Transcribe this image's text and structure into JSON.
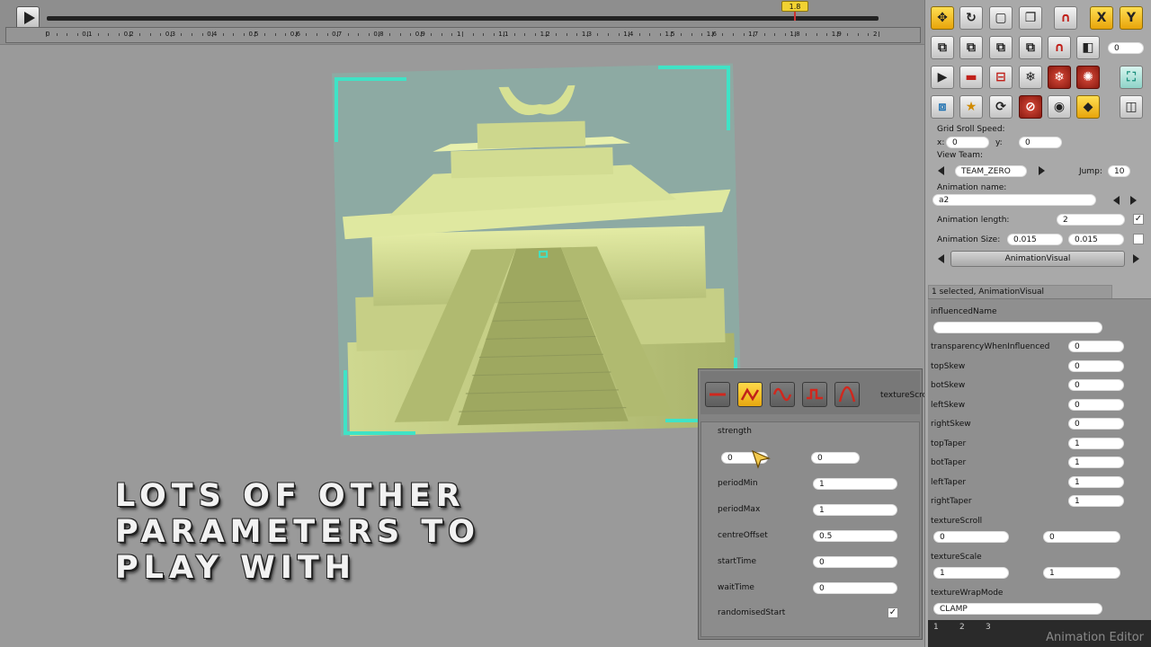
{
  "timeline": {
    "playhead_value": "1.8",
    "ticks": [
      "0",
      "0.1",
      "0.2",
      "0.3",
      "0.4",
      "0.5",
      "0.6",
      "0.7",
      "0.8",
      "0.9",
      "1",
      "1.1",
      "1.2",
      "1.3",
      "1.4",
      "1.5",
      "1.6",
      "1.7",
      "1.8",
      "1.9",
      "2"
    ]
  },
  "overlay": {
    "line1": "LOTS OF OTHER",
    "line2": "PARAMETERS TO",
    "line3": "PLAY WiTH"
  },
  "texture_scroll_panel": {
    "title": "textureScroll",
    "wave_buttons": [
      "flat-wave-icon",
      "triangle-wave-icon",
      "sine-wave-icon",
      "square-wave-icon",
      "spike-wave-icon"
    ],
    "active_wave": "triangle-wave-icon",
    "strength_label": "strength",
    "strength_a": "0",
    "strength_b": "0",
    "rows": [
      {
        "label": "periodMin",
        "value": "1"
      },
      {
        "label": "periodMax",
        "value": "1"
      },
      {
        "label": "centreOffset",
        "value": "0.5"
      },
      {
        "label": "startTime",
        "value": "0"
      },
      {
        "label": "waitTime",
        "value": "0"
      }
    ],
    "randomised_label": "randomisedStart",
    "randomised_checked": "✓"
  },
  "toolbar": {
    "row1": [
      "move-icon",
      "refresh-icon",
      "layer-icon",
      "duplicate-icon",
      "magnet-icon",
      "x-axis-icon",
      "y-axis-icon"
    ],
    "row2": [
      "send-back-icon",
      "bring-forward-icon",
      "stack-icon",
      "ungroup-icon",
      "magnet-small-icon",
      "flip-icon"
    ],
    "row2_value": "0",
    "row3": [
      "play-icon",
      "record-icon",
      "split-icon",
      "snow-icon",
      "snow-red-icon",
      "wheel-red-icon",
      "fit-icon"
    ],
    "row4": [
      "group-icon",
      "star-icon",
      "cycle-icon",
      "no-eye-icon",
      "eye-icon",
      "keyframe-icon",
      "mirror-icon"
    ]
  },
  "settings": {
    "grid_scroll_label": "Grid Sroll Speed:",
    "x_label": "x:",
    "x_value": "0",
    "y_label": "y:",
    "y_value": "0",
    "view_team_label": "View Team:",
    "team_value": "TEAM_ZERO",
    "jump_label": "Jump:",
    "jump_value": "10",
    "anim_name_label": "Animation name:",
    "anim_name_value": "a2",
    "anim_length_label": "Animation length:",
    "anim_length_value": "2",
    "anim_length_checked": "✓",
    "anim_size_label": "Animation Size:",
    "anim_size_x": "0.015",
    "anim_size_y": "0.015",
    "visual_selector": "AnimationVisual"
  },
  "properties": {
    "selection_tab": "1 selected, AnimationVisual",
    "influenced_name_label": "influencedName",
    "influenced_name_value": "",
    "rows": [
      {
        "label": "transparencyWhenInfluenced",
        "value": "0"
      },
      {
        "label": "topSkew",
        "value": "0"
      },
      {
        "label": "botSkew",
        "value": "0"
      },
      {
        "label": "leftSkew",
        "value": "0"
      },
      {
        "label": "rightSkew",
        "value": "0"
      },
      {
        "label": "topTaper",
        "value": "1"
      },
      {
        "label": "botTaper",
        "value": "1"
      },
      {
        "label": "leftTaper",
        "value": "1"
      },
      {
        "label": "rightTaper",
        "value": "1"
      }
    ],
    "texture_scroll_label": "textureScroll",
    "texture_scroll_a": "0",
    "texture_scroll_b": "0",
    "texture_scale_label": "textureScale",
    "texture_scale_a": "1",
    "texture_scale_b": "1",
    "texture_wrap_label": "textureWrapMode",
    "texture_wrap_value": "CLAMP"
  },
  "bottom_tabs": [
    "1",
    "2",
    "3"
  ],
  "editor_label": "Animation Editor",
  "colors": {
    "accent_yellow": "#f1c232",
    "bracket_teal": "#3fe3c6",
    "background": "#9a9a9a"
  }
}
